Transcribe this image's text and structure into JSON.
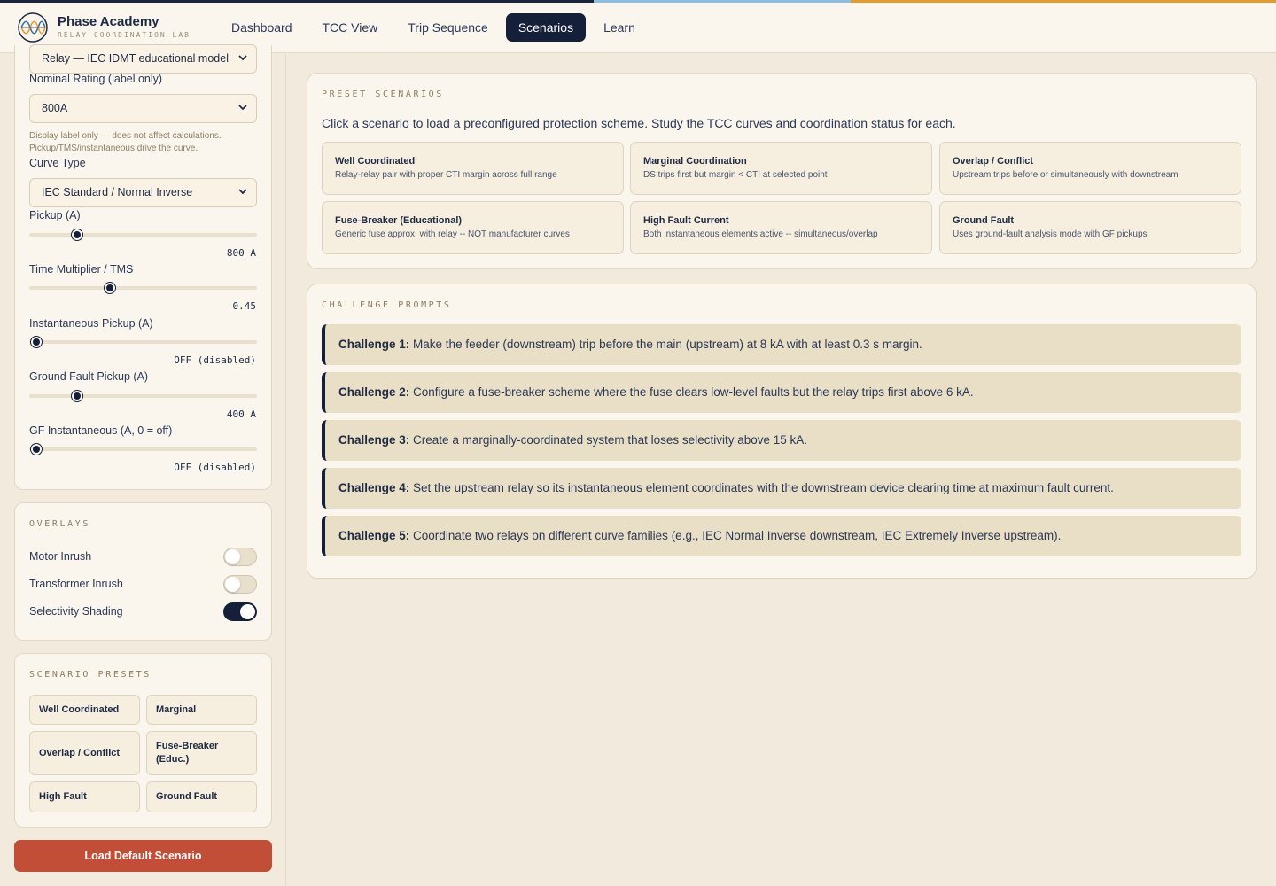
{
  "app": {
    "title": "Phase Academy",
    "subtitle": "RELAY COORDINATION LAB"
  },
  "nav": {
    "tabs": [
      {
        "label": "Dashboard"
      },
      {
        "label": "TCC View"
      },
      {
        "label": "Trip Sequence"
      },
      {
        "label": "Scenarios",
        "active": true
      },
      {
        "label": "Learn"
      }
    ]
  },
  "sidebar": {
    "device_model": "Relay — IEC IDMT educational model",
    "nominal_rating": {
      "label": "Nominal Rating (label only)",
      "value": "800A",
      "note": "Display label only — does not affect calculations. Pickup/TMS/instantaneous drive the curve."
    },
    "curve_type": {
      "label": "Curve Type",
      "value": "IEC Standard / Normal Inverse"
    },
    "sliders": {
      "pickup": {
        "label": "Pickup (A)",
        "display": "800 A",
        "fraction": 0.21
      },
      "tms": {
        "label": "Time Multiplier / TMS",
        "display": "0.45",
        "fraction": 0.355
      },
      "inst": {
        "label": "Instantaneous Pickup (A)",
        "display": "OFF (disabled)",
        "fraction": 0.03
      },
      "gf": {
        "label": "Ground Fault Pickup (A)",
        "display": "400 A",
        "fraction": 0.21
      },
      "gf_inst": {
        "label": "GF Instantaneous (A, 0 = off)",
        "display": "OFF (disabled)",
        "fraction": 0.03
      }
    },
    "overlays": {
      "title": "OVERLAYS",
      "items": [
        {
          "label": "Motor Inrush",
          "on": false
        },
        {
          "label": "Transformer Inrush",
          "on": false
        },
        {
          "label": "Selectivity Shading",
          "on": true
        }
      ]
    },
    "presets": {
      "title": "SCENARIO PRESETS",
      "buttons": [
        "Well Coordinated",
        "Marginal",
        "Overlap / Conflict",
        "Fuse-Breaker (Educ.)",
        "High Fault",
        "Ground Fault"
      ]
    },
    "load_default": "Load Default Scenario"
  },
  "main": {
    "preset_scenarios": {
      "title": "PRESET SCENARIOS",
      "description": "Click a scenario to load a preconfigured protection scheme. Study the TCC curves and coordination status for each.",
      "cards": [
        {
          "name": "Well Coordinated",
          "desc": "Relay-relay pair with proper CTI margin across full range"
        },
        {
          "name": "Marginal Coordination",
          "desc": "DS trips first but margin < CTI at selected point"
        },
        {
          "name": "Overlap / Conflict",
          "desc": "Upstream trips before or simultaneously with downstream"
        },
        {
          "name": "Fuse-Breaker (Educational)",
          "desc": "Generic fuse approx. with relay -- NOT manufacturer curves"
        },
        {
          "name": "High Fault Current",
          "desc": "Both instantaneous elements active -- simultaneous/overlap"
        },
        {
          "name": "Ground Fault",
          "desc": "Uses ground-fault analysis mode with GF pickups"
        }
      ]
    },
    "challenges": {
      "title": "CHALLENGE PROMPTS",
      "items": [
        {
          "label": "Challenge 1:",
          "text": "Make the feeder (downstream) trip before the main (upstream) at 8 kA with at least 0.3 s margin."
        },
        {
          "label": "Challenge 2:",
          "text": "Configure a fuse-breaker scheme where the fuse clears low-level faults but the relay trips first above 6 kA."
        },
        {
          "label": "Challenge 3:",
          "text": "Create a marginally-coordinated system that loses selectivity above 15 kA."
        },
        {
          "label": "Challenge 4:",
          "text": "Set the upstream relay so its instantaneous element coordinates with the downstream device clearing time at maximum fault current."
        },
        {
          "label": "Challenge 5:",
          "text": "Coordinate two relays on different curve families (e.g., IEC Normal Inverse downstream, IEC Extremely Inverse upstream)."
        }
      ]
    }
  },
  "colors": {
    "navy": "#14203a",
    "accent_red": "#c24e38",
    "cream": "#faf6ee",
    "stripe_blue": "#8fbfe0",
    "stripe_orange": "#e59a2c"
  }
}
